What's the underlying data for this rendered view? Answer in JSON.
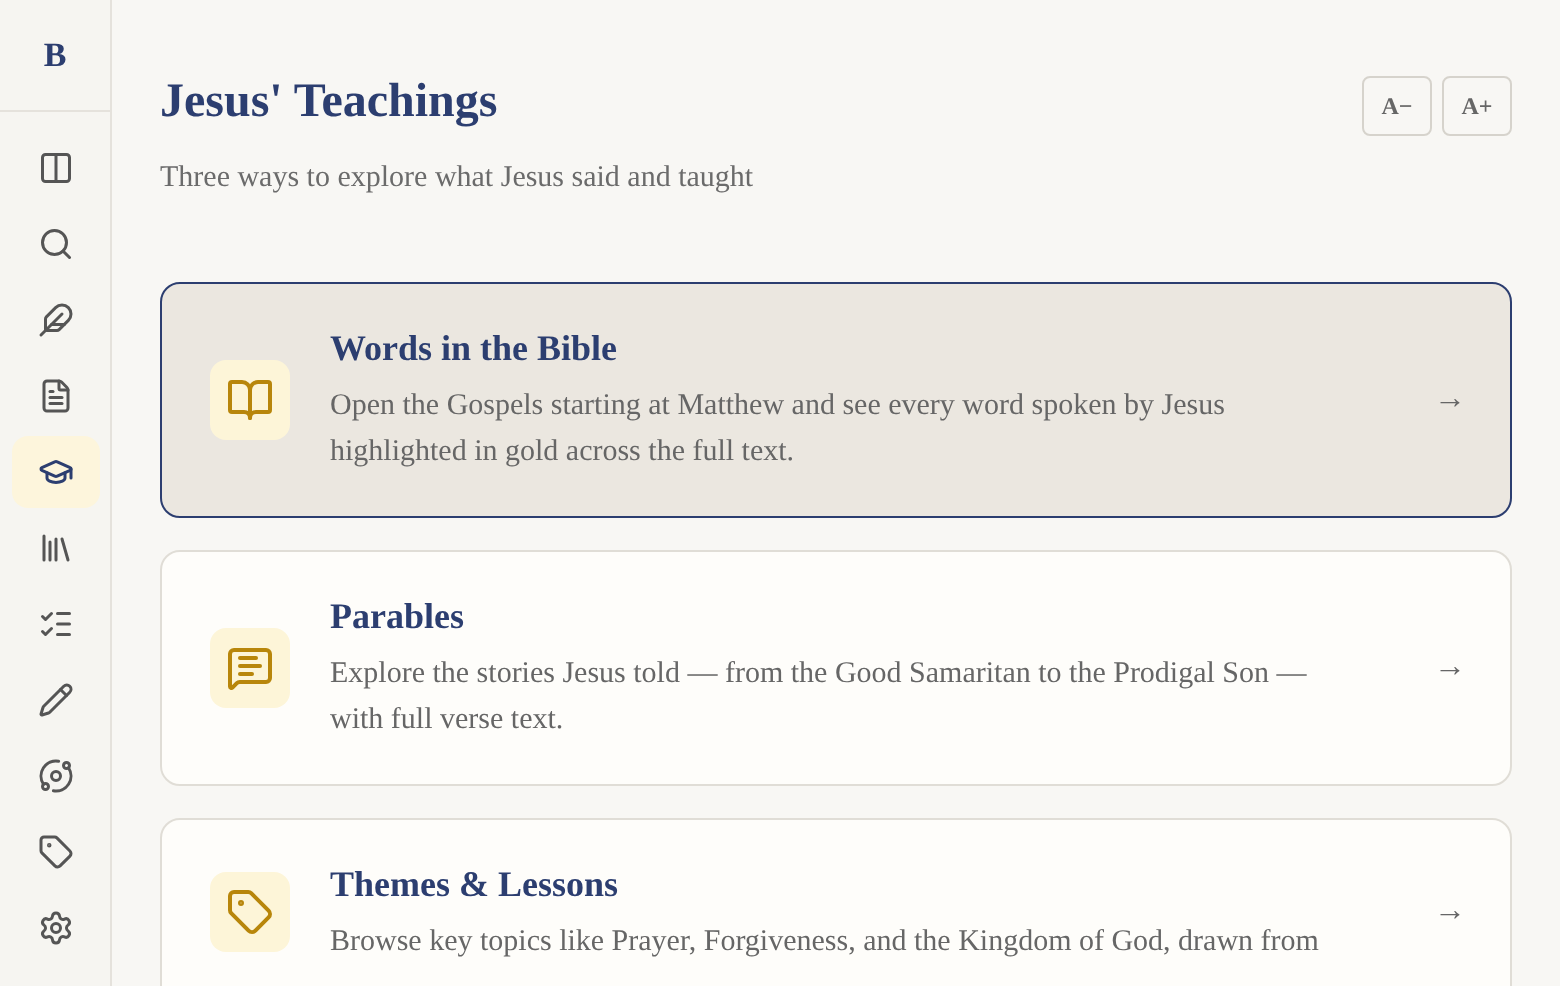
{
  "sidebar": {
    "logo": "B",
    "items": [
      {
        "selected": false
      },
      {
        "selected": false
      },
      {
        "selected": false
      },
      {
        "selected": false
      },
      {
        "selected": true
      },
      {
        "selected": false
      },
      {
        "selected": false
      },
      {
        "selected": false
      },
      {
        "selected": false
      },
      {
        "selected": false
      },
      {
        "selected": false
      }
    ]
  },
  "header": {
    "title": "Jesus' Teachings",
    "subtitle": "Three ways to explore what Jesus said and taught",
    "font_buttons": [
      "A−",
      "A+"
    ]
  },
  "cards": [
    {
      "title": "Words in the Bible",
      "description": "Open the Gospels starting at Matthew and see every word spoken by Jesus highlighted in gold across the full text.",
      "arrow": "→",
      "selected": true
    },
    {
      "title": "Parables",
      "description": "Explore the stories Jesus told — from the Good Samaritan to the Prodigal Son — with full verse text.",
      "arrow": "→",
      "selected": false
    },
    {
      "title": "Themes & Lessons",
      "description": "Browse key topics like Prayer, Forgiveness, and the Kingdom of God, drawn from",
      "arrow": "→",
      "selected": false
    }
  ]
}
